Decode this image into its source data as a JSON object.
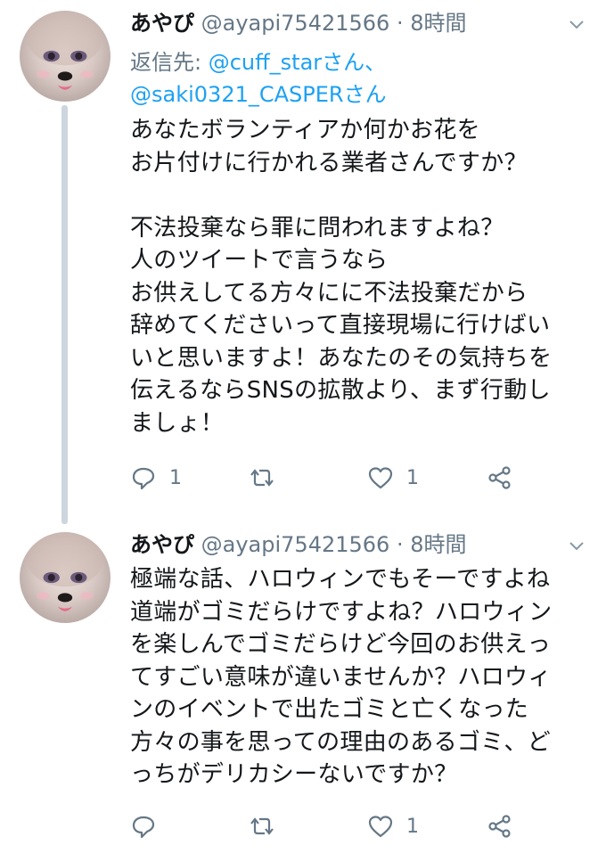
{
  "tweets": [
    {
      "name": "あやぴ",
      "handle": "@ayapi75421566",
      "time": "8時間",
      "reply_prefix": "返信先: ",
      "reply_mention1": "@cuff_starさん、",
      "reply_mention2": "@saki0321_CASPERさん",
      "body": "あなたボランティアか何かお花を\nお片付けに行かれる業者さんですか？\n\n不法投棄なら罪に問われますよね？\n人のツイートで言うなら\nお供えしてる方々にに不法投棄だから\n辞めてくださいって直接現場に行けばい\nいと思いますよ！あなたのその気持ちを\n伝えるならSNSの拡散より、まず行動し\nましょ！",
      "reply_count": "1",
      "retweet_count": "",
      "like_count": "1"
    },
    {
      "name": "あやぴ",
      "handle": "@ayapi75421566",
      "time": "8時間",
      "body": "極端な話、ハロウィンでもそーですよね\n道端がゴミだらけですよね？ハロウィン\nを楽しんでゴミだらけど今回のお供えっ\nてすごい意味が違いませんか？ハロウィ\nンのイベントで出たゴミと亡くなった\n方々の事を思っての理由のあるゴミ、ど\nっちがデリカシーないですか？",
      "reply_count": "",
      "retweet_count": "",
      "like_count": "1"
    }
  ],
  "separator": " · ",
  "colors": {
    "text": "#14171a",
    "secondary": "#657786",
    "link": "#1da1f2",
    "thread_line": "#cdd6de"
  }
}
